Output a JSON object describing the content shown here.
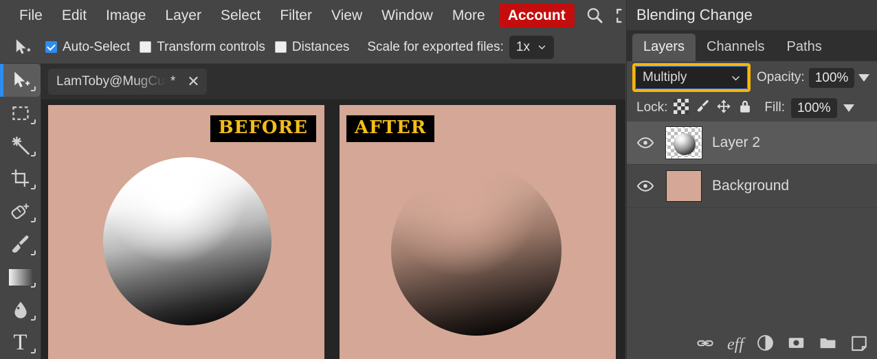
{
  "menubar": {
    "items": [
      {
        "label": "File",
        "name": "menu-file"
      },
      {
        "label": "Edit",
        "name": "menu-edit"
      },
      {
        "label": "Image",
        "name": "menu-image"
      },
      {
        "label": "Layer",
        "name": "menu-layer"
      },
      {
        "label": "Select",
        "name": "menu-select"
      },
      {
        "label": "Filter",
        "name": "menu-filter"
      },
      {
        "label": "View",
        "name": "menu-view"
      },
      {
        "label": "Window",
        "name": "menu-window"
      },
      {
        "label": "More",
        "name": "menu-more"
      }
    ],
    "account_label": "Account",
    "account_color": "#c40d0d",
    "search_icon": "search-icon",
    "fullscreen_icon": "fullscreen-icon"
  },
  "options_bar": {
    "tool_icon": "move-tool-icon",
    "auto_select": {
      "label": "Auto-Select",
      "checked": true
    },
    "transform_controls": {
      "label": "Transform controls",
      "checked": false
    },
    "distances": {
      "label": "Distances",
      "checked": false
    },
    "scale_label": "Scale for exported files:",
    "scale_value": "1x"
  },
  "toolbar": {
    "tools": [
      {
        "name": "move-tool",
        "icon": "move-cursor-icon",
        "active": true
      },
      {
        "name": "marquee-tool",
        "icon": "rectangular-marquee-icon",
        "active": false
      },
      {
        "name": "magic-wand-tool",
        "icon": "magic-wand-icon",
        "active": false
      },
      {
        "name": "crop-tool",
        "icon": "crop-icon",
        "active": false
      },
      {
        "name": "patch-tool",
        "icon": "patch-heal-icon",
        "active": false
      },
      {
        "name": "brush-tool",
        "icon": "paintbrush-icon",
        "active": false
      },
      {
        "name": "gradient-tool",
        "icon": "gradient-icon",
        "active": false
      },
      {
        "name": "blur-tool",
        "icon": "water-drop-icon",
        "active": false
      },
      {
        "name": "text-tool",
        "icon": "text-t-icon",
        "active": false
      }
    ]
  },
  "document_tab": {
    "name": "LamToby@MugCute",
    "dirty_marker": "*",
    "close_icon": "close-icon"
  },
  "canvas": {
    "background_color": "#d4a796",
    "gutter_color": "#252525",
    "before": {
      "badge": "BEFORE",
      "description": "Gradient sphere, white to black, normal blend mode on salmon background"
    },
    "after": {
      "badge": "AFTER",
      "description": "Same gradient sphere with Multiply blend mode applied over salmon background"
    },
    "badge_text_color": "#f5bd19",
    "badge_bg_color": "#000000"
  },
  "right_panel": {
    "title": "Blending Change",
    "tabs": [
      {
        "label": "Layers",
        "name": "tab-layers",
        "active": true
      },
      {
        "label": "Channels",
        "name": "tab-channels",
        "active": false
      },
      {
        "label": "Paths",
        "name": "tab-paths",
        "active": false
      }
    ],
    "blend_mode": {
      "value": "Multiply",
      "highlight_color": "#f5b60a",
      "focus_color": "#4a90e8"
    },
    "opacity": {
      "label": "Opacity:",
      "value": "100%"
    },
    "lock": {
      "label": "Lock:",
      "icons": [
        "lock-transparency-icon",
        "lock-pixels-icon",
        "lock-position-icon",
        "lock-all-icon"
      ]
    },
    "fill": {
      "label": "Fill:",
      "value": "100%"
    },
    "layers": [
      {
        "name": "Layer 2",
        "visible": true,
        "selected": true,
        "thumb_type": "transparent-gradient-sphere",
        "eye_icon": "eye-icon"
      },
      {
        "name": "Background",
        "visible": true,
        "selected": false,
        "thumb_type": "solid-salmon",
        "eye_icon": "eye-icon"
      }
    ],
    "bottom_buttons": [
      {
        "name": "link-layers-button",
        "icon": "link-icon"
      },
      {
        "name": "layer-effects-button",
        "icon": "fx-icon"
      },
      {
        "name": "adjustment-layer-button",
        "icon": "half-circle-icon"
      },
      {
        "name": "layer-mask-button",
        "icon": "mask-icon"
      },
      {
        "name": "new-group-button",
        "icon": "folder-icon"
      },
      {
        "name": "new-layer-button",
        "icon": "new-layer-icon"
      }
    ]
  }
}
